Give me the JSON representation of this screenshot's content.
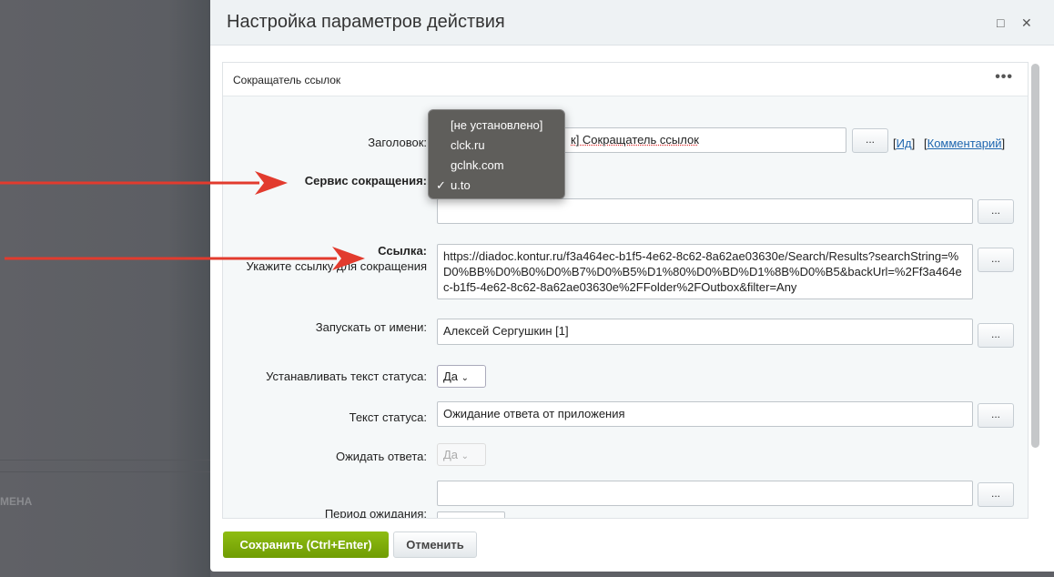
{
  "background": {
    "partial_label": "МЕНА"
  },
  "dialog": {
    "title": "Настройка параметров действия",
    "maximize_icon": "□",
    "close_icon": "✕"
  },
  "panel": {
    "title": "Сокращатель ссылок",
    "menu_icon": "•••"
  },
  "fields": {
    "title_label": "Заголовок:",
    "title_value": "к] Сокращатель ссылок",
    "id_link": "Ид",
    "comment_link": "Комментарий",
    "service_label": "Сервис сокращения:",
    "service_dropdown": {
      "options": [
        "[не установлено]",
        "clck.ru",
        "gclnk.com",
        "u.to"
      ],
      "selected": "u.to",
      "check": "✓"
    },
    "link_label": "Ссылка:",
    "link_hint": "Укажите ссылку для сокращения",
    "link_value": "https://diadoc.kontur.ru/f3a464ec-b1f5-4e62-8c62-8a62ae03630e/Search/Results?searchString=%D0%BB%D0%B0%D0%B7%D0%B5%D1%80%D0%BD%D1%8B%D0%B5&backUrl=%2Ff3a464ec-b1f5-4e62-8c62-8a62ae03630e%2FFolder%2FOutbox&filter=Any",
    "run_as_label": "Запускать от имени:",
    "run_as_value": "Алексей Сергушкин [1]",
    "set_status_label": "Устанавливать текст статуса:",
    "set_status_value": "Да",
    "status_text_label": "Текст статуса:",
    "status_text_value": "Ожидание ответа от приложения",
    "wait_label": "Ожидать ответа:",
    "wait_value": "Да",
    "period_label": "Период ожидания:",
    "more_button": "..."
  },
  "footer": {
    "save": "Сохранить (Ctrl+Enter)",
    "cancel": "Отменить"
  },
  "colors": {
    "arrow": "#e23b2e",
    "save": "#7aa80a"
  }
}
